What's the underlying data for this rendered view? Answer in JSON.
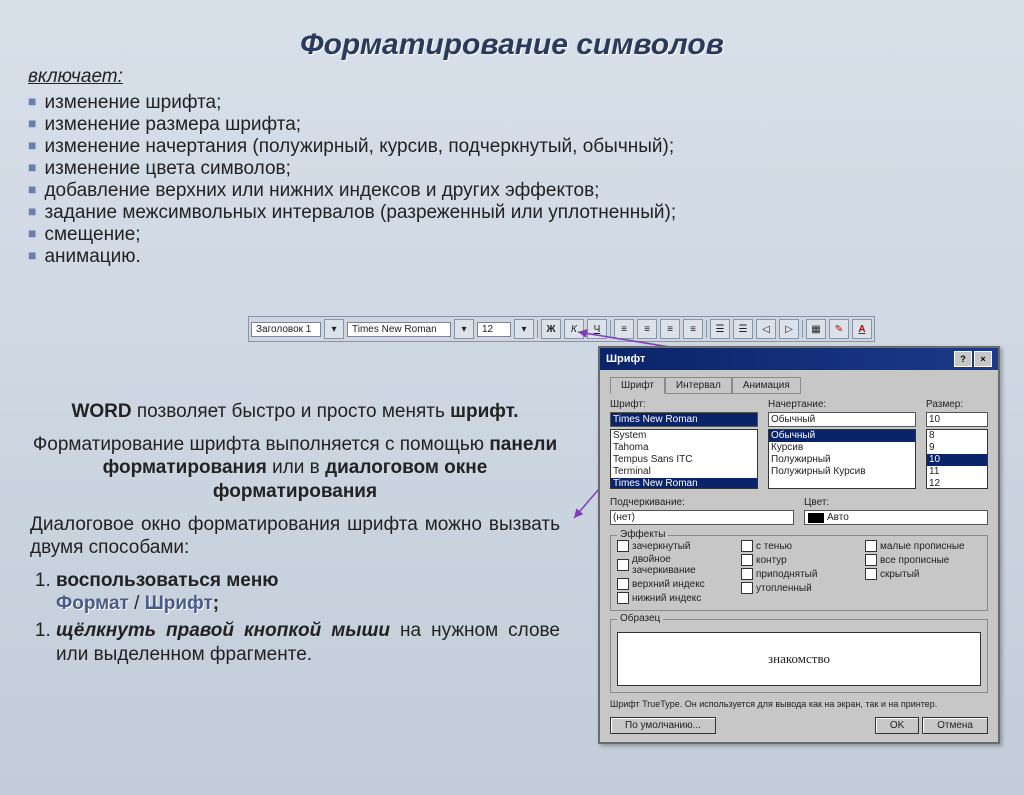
{
  "title": "Форматирование символов",
  "intro": "включает:",
  "bullets": [
    "изменение шрифта;",
    "изменение размера шрифта;",
    "изменение начертания (полужирный, курсив, подчеркнутый, обычный);",
    "изменение цвета символов;",
    "добавление верхних или нижних индексов и других эффектов;",
    "задание межсимвольных интервалов (разреженный или уплотненный);",
    "смещение;",
    "анимацию."
  ],
  "toolbar": {
    "style": "Заголовок 1",
    "font": "Times New Roman",
    "size": "12",
    "bold": "Ж",
    "italic": "К",
    "underline": "Ч"
  },
  "body": {
    "p1a": "WORD",
    "p1b": " позволяет быстро и просто менять ",
    "p1c": "шрифт.",
    "p2a": "Форматирование шрифта выполняется с помощью ",
    "p2b": "панели форматирования",
    "p2c": "     или в ",
    "p2d": "диалоговом окне форматирования",
    "p3": "Диалоговое окно форматирования шрифта можно вызвать двумя способами:",
    "l1a": "воспользоваться меню",
    "l1b": "Формат",
    "l1sep": " / ",
    "l1c": "Шрифт",
    "l1d": ";",
    "l2a": "щёлкнуть правой кнопкой мыши",
    "l2b": " на нужном слове или выделенном фрагменте."
  },
  "dlg": {
    "title": "Шрифт",
    "tabs": [
      "Шрифт",
      "Интервал",
      "Анимация"
    ],
    "font_label": "Шрифт:",
    "font_value": "Times New Roman",
    "font_list": [
      "System",
      "Tahoma",
      "Tempus Sans ITC",
      "Terminal",
      "Times New Roman"
    ],
    "style_label": "Начертание:",
    "style_value": "Обычный",
    "style_list": [
      "Обычный",
      "Курсив",
      "Полужирный",
      "Полужирный Курсив"
    ],
    "size_label": "Размер:",
    "size_value": "10",
    "size_list": [
      "8",
      "9",
      "10",
      "11",
      "12"
    ],
    "underline_label": "Подчеркивание:",
    "underline_value": "(нет)",
    "color_label": "Цвет:",
    "color_value": "Авто",
    "effects_label": "Эффекты",
    "effects_col1": [
      "зачеркнутый",
      "двойное зачеркивание",
      "верхний индекс",
      "нижний индекс"
    ],
    "effects_col2": [
      "с тенью",
      "контур",
      "приподнятый",
      "утопленный"
    ],
    "effects_col3": [
      "малые прописные",
      "все прописные",
      "скрытый"
    ],
    "sample_label": "Образец",
    "sample_text": "знакомство",
    "footer_text": "Шрифт TrueType. Он используется для вывода как на экран, так и на принтер.",
    "btn_default": "По умолчанию...",
    "btn_ok": "OK",
    "btn_cancel": "Отмена"
  }
}
